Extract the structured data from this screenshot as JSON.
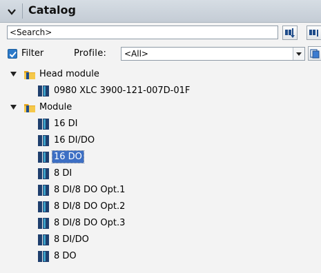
{
  "panel": {
    "title": "Catalog"
  },
  "search": {
    "text": "<Search>"
  },
  "filter": {
    "label": "Filter",
    "checked": true,
    "profile_label": "Profile:",
    "profile_value": "<All>"
  },
  "tree": {
    "head_module": "Head module",
    "head_item": "0980 XLC 3900-121-007D-01F",
    "module": "Module",
    "items": [
      "16 DI",
      "16 DI/DO",
      "16 DO",
      "8 DI",
      "8 DI/8 DO Opt.1",
      "8 DI/8 DO Opt.2",
      "8 DI/8 DO Opt.3",
      "8 DI/DO",
      "8 DO"
    ],
    "selected_item": "16 DO"
  },
  "colors": {
    "selection": "#3d6fc4",
    "folder": "#e8a820",
    "module_icon": "#1f3f6e"
  }
}
